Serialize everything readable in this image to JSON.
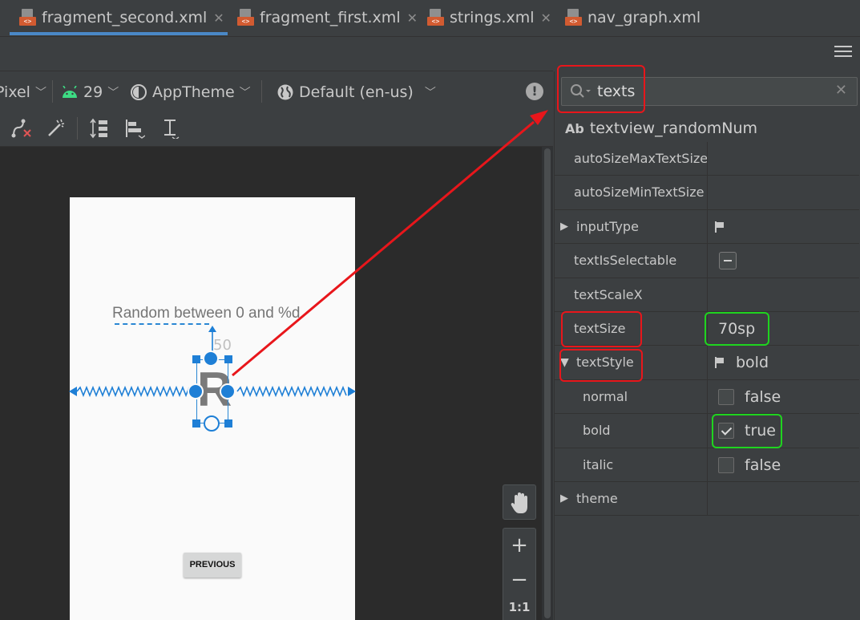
{
  "tabs": [
    {
      "label": "fragment_second.xml",
      "badge": "<>",
      "active": true
    },
    {
      "label": "fragment_first.xml",
      "badge": "<>"
    },
    {
      "label": "strings.xml",
      "badge": "<>"
    },
    {
      "label": "nav_graph.xml",
      "badge": "<>"
    }
  ],
  "tab_close_glyph": "✕",
  "config_toolbar": {
    "device": "Pixel",
    "api_level": "29",
    "theme": "AppTheme",
    "locale": "Default (en-us)",
    "warning_glyph": "!"
  },
  "canvas": {
    "random_text": "Random between 0 and %d",
    "selected_char": "R",
    "margin_value": "50",
    "previous_button": "PREVIOUS"
  },
  "zoom": {
    "zoom_in": "+",
    "zoom_out": "−",
    "fit": "1:1"
  },
  "attributes": {
    "search_value": "texts",
    "clear_glyph": "✕",
    "component_icon": "Ab",
    "component_name": "textview_randomNum",
    "rows": [
      {
        "name": "autoSizeMaxTextSize",
        "value": ""
      },
      {
        "name": "autoSizeMinTextSize",
        "value": ""
      },
      {
        "name": "inputType",
        "value": ""
      },
      {
        "name": "textIsSelectable",
        "value": ""
      },
      {
        "name": "textScaleX",
        "value": ""
      },
      {
        "name": "textSize",
        "value": "70sp"
      },
      {
        "name": "textStyle",
        "value": "bold"
      },
      {
        "name": "normal",
        "value": "false"
      },
      {
        "name": "bold",
        "value": "true"
      },
      {
        "name": "italic",
        "value": "false"
      },
      {
        "name": "theme",
        "value": ""
      }
    ]
  },
  "colors": {
    "accent_blue": "#1e7fd6",
    "annotation_red": "#e8161b",
    "annotation_green": "#1fd41f",
    "ide_background": "#3c3f41"
  }
}
